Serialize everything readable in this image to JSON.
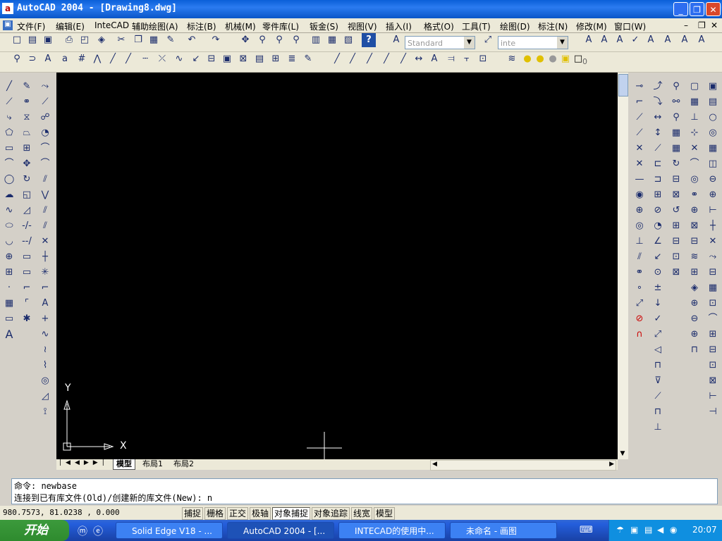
{
  "window": {
    "title": "AutoCAD 2004 - [Drawing8.dwg]"
  },
  "menu": [
    "文件(F)",
    "编辑(E)",
    "InteCAD",
    "辅助绘图(A)",
    "标注(B)",
    "机械(M)",
    "零件库(L)",
    "钣金(S)",
    "视图(V)",
    "插入(I)",
    "格式(O)",
    "工具(T)",
    "绘图(D)",
    "标注(N)",
    "修改(M)",
    "窗口(W)"
  ],
  "toolbar": {
    "text_style": "Standard",
    "dim_style": "inte",
    "layer": "0"
  },
  "tabs": [
    "模型",
    "布局1",
    "布局2"
  ],
  "ucs": {
    "x_label": "X",
    "y_label": "Y"
  },
  "command": {
    "line1": "命令: newbase",
    "line2": "连接到已有库文件(Old)/创建新的库文件(New): n"
  },
  "status": {
    "coords": "980.7573, 81.0238 , 0.000",
    "buttons": [
      "捕捉",
      "栅格",
      "正交",
      "极轴",
      "对象捕捉",
      "对象追踪",
      "线宽",
      "模型"
    ]
  },
  "taskbar": {
    "start": "开始",
    "items": [
      "Solid Edge V18 - ...",
      "AutoCAD 2004 - [...",
      "INTECAD的使用中...",
      "未命名 - 画图"
    ],
    "clock": "20:07"
  }
}
